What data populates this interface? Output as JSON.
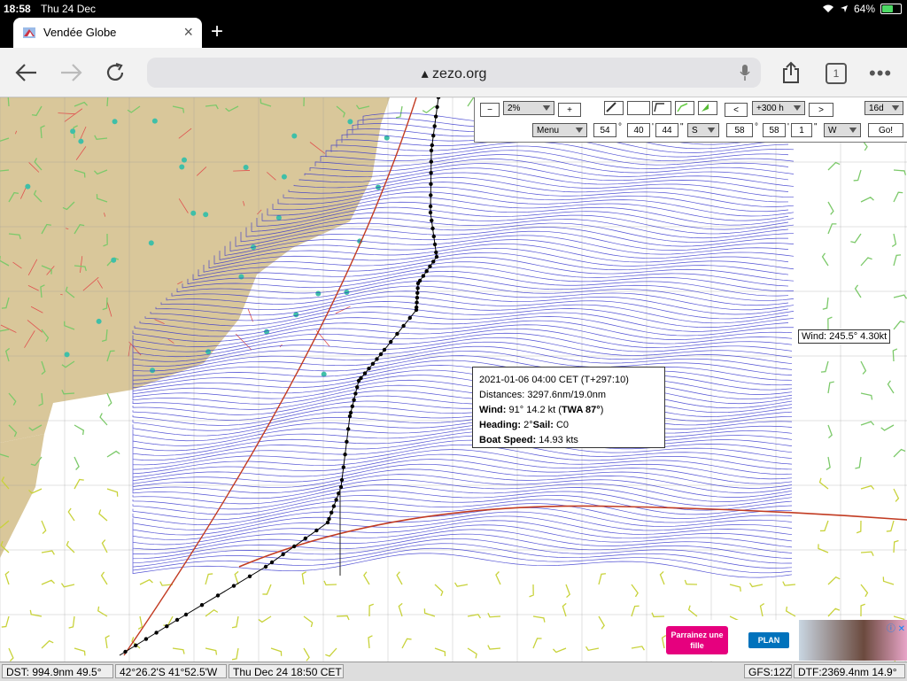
{
  "status": {
    "time": "18:58",
    "date": "Thu 24 Dec",
    "battery": "64%",
    "battery_level": 0.64
  },
  "tab": {
    "title": "Vendée Globe",
    "close": "×"
  },
  "new_tab": "+",
  "url": "zezo.org",
  "tab_count": "1",
  "more": "•••",
  "toolbar": {
    "zoom_minus": "−",
    "zoom_value": "2%",
    "zoom_plus": "+",
    "prev": "<",
    "time_step": "+300 h",
    "next": ">",
    "forecast": "16d",
    "menu": "Menu",
    "lat_deg": "54",
    "lat_min": "40",
    "lat_sec": "44",
    "lat_hem": "S",
    "lon_deg": "58",
    "lon_min": "58",
    "lon_sec": "1",
    "lon_hem": "W",
    "go": "Go!",
    "deg_sym": "°",
    "min_sym": "'",
    "sec_sym": "\""
  },
  "wind_label": "Wind: 245.5° 4.30kt",
  "popup": {
    "line1": "2021-01-06 04:00 CET (T+297:10)",
    "distances": "Distances: 3297.6nm/19.0nm",
    "wind_label": "Wind:",
    "wind_value": "91° 14.2 kt (",
    "twa": "TWA 87°",
    "wind_close": ")",
    "heading_label": "Heading:",
    "heading_value": "2°",
    "sail_label": "Sail:",
    "sail_value": "C0",
    "speed_label": "Boat Speed:",
    "speed_value": "14.93 kts"
  },
  "ad": {
    "button": "Parrainez une fille",
    "logo": "PLAN",
    "close": "ⓘ ✕"
  },
  "bottom": {
    "dst": "DST: 994.9nm  49.5°",
    "position": "42°26.2'S  41°52.5'W",
    "datetime": "Thu Dec 24 18:50 CET",
    "gfs": "GFS:12Z",
    "dtf": "DTF:2369.4nm  14.9°"
  },
  "colors": {
    "land": "#d9c79a",
    "border": "#e0524f",
    "isochrone": "#3333cc",
    "route": "#000000",
    "great_circle": "#c23b22"
  }
}
